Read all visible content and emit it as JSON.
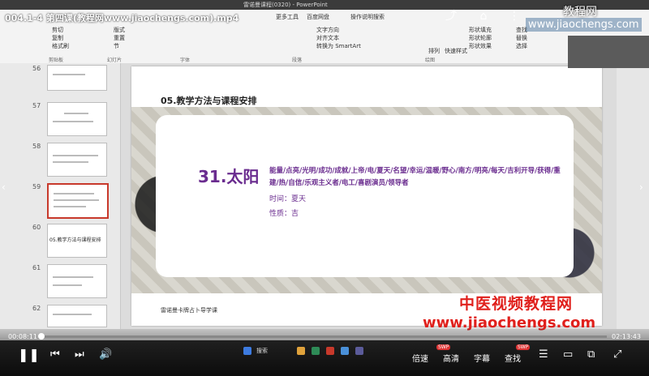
{
  "video": {
    "title": "004.1-4 第四课(教程网www.jiaochengs.com).mp4",
    "current_time": "00:08:11",
    "total_time": "02:13:43",
    "progress": 0.004
  },
  "watermark": {
    "top_cn": "教程网",
    "top_url": "www.jiaochengs.com",
    "bottom_cn": "中医视频教程网",
    "bottom_url": "www.jiaochengs.com"
  },
  "ppt": {
    "window_title": "雷诺曼课程(0320) - PowerPoint",
    "ribbon_tabs": [
      "更多工具",
      "百度网盘",
      "操作说明搜索"
    ],
    "ribbon_groups": [
      "剪贴板",
      "幻灯片",
      "字体",
      "段落",
      "绘图"
    ],
    "ribbon_buttons": [
      "剪切",
      "复制",
      "格式刷",
      "版式",
      "重置",
      "节",
      "文字方向",
      "对齐文本",
      "转换为 SmartArt",
      "形状填充",
      "形状轮廓",
      "形状效果",
      "排列",
      "快速样式",
      "查找",
      "替换",
      "选择"
    ],
    "slide_numbers": [
      "56",
      "57",
      "58",
      "59",
      "60",
      "61",
      "62"
    ],
    "thumb_60_text": "05.教学方法与课程安排"
  },
  "slide": {
    "title": "05.教学方法与课程安排",
    "card_title": "31.太阳",
    "keywords": "能量/点亮/光明/成功/成就/上帝/电/夏天/名望/幸运/温暖/野心/南方/明亮/每天/吉利开导/获得/重建/热/自信/乐观主义者/电工/喜剧演员/领导者",
    "time_label": "时间：夏天",
    "nature_label": "性质：吉",
    "footer": "雷诺曼卡牌占卜导学课"
  },
  "controls": {
    "speed": "倍速",
    "quality": "高清",
    "subtitle": "字幕",
    "search": "查找",
    "swp": "SWP",
    "taskbar_search": "搜索"
  },
  "colors": {
    "accent_purple": "#6a2c8f",
    "watermark_red": "#e0201c"
  }
}
